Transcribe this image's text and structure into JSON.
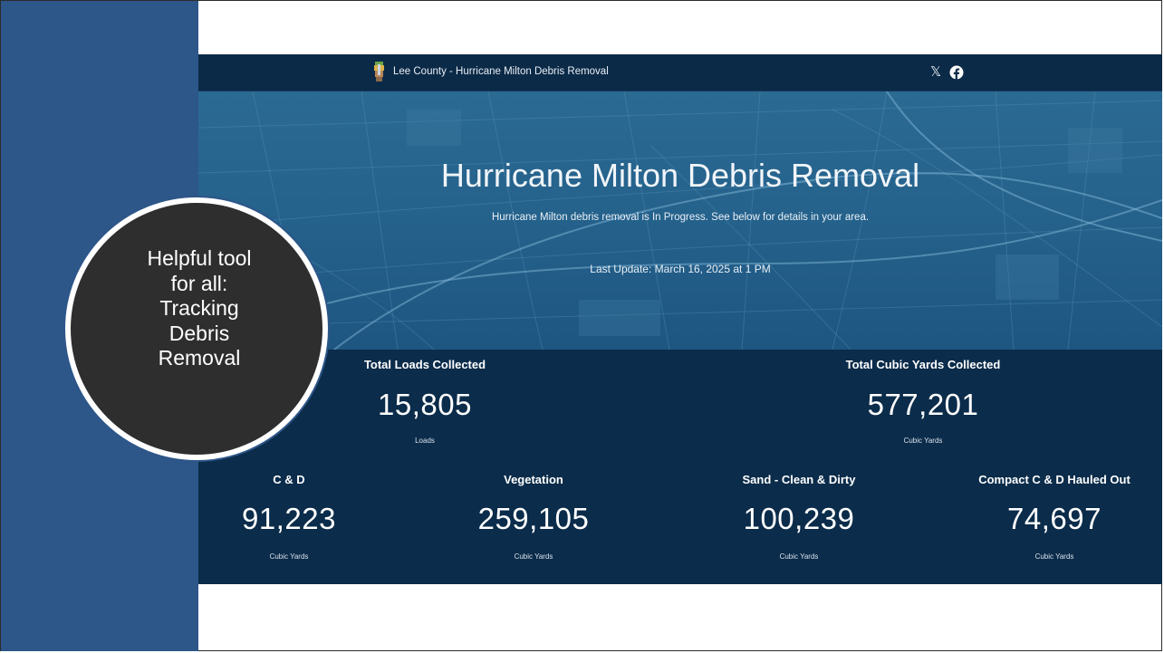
{
  "header": {
    "title": "Lee County - Hurricane Milton Debris Removal"
  },
  "hero": {
    "title": "Hurricane Milton Debris Removal",
    "subtitle": "Hurricane Milton debris removal is In Progress. See below for details in your area.",
    "last_update": "Last Update: March 16, 2025 at 1 PM"
  },
  "stats_top": [
    {
      "label": "Total Loads Collected",
      "value": "15,805",
      "unit": "Loads"
    },
    {
      "label": "Total Cubic Yards Collected",
      "value": "577,201",
      "unit": "Cubic Yards"
    }
  ],
  "stats_bottom": [
    {
      "label": "C & D",
      "value": "91,223",
      "unit": "Cubic Yards"
    },
    {
      "label": "Vegetation",
      "value": "259,105",
      "unit": "Cubic Yards"
    },
    {
      "label": "Sand - Clean & Dirty",
      "value": "100,239",
      "unit": "Cubic Yards"
    },
    {
      "label": "Compact C & D Hauled Out",
      "value": "74,697",
      "unit": "Cubic Yards"
    }
  ],
  "callout": {
    "lines": [
      "Helpful tool",
      "for all:",
      "Tracking",
      "Debris",
      "Removal"
    ]
  },
  "icons": {
    "social_x": "x-icon",
    "social_facebook": "facebook-icon",
    "logo": "lee-county-logo"
  },
  "colors": {
    "band": "#2d5689",
    "dashboard_bg": "#0b2c4a",
    "hero_bg": "#25628c",
    "callout_bg": "#2e2e2e"
  }
}
